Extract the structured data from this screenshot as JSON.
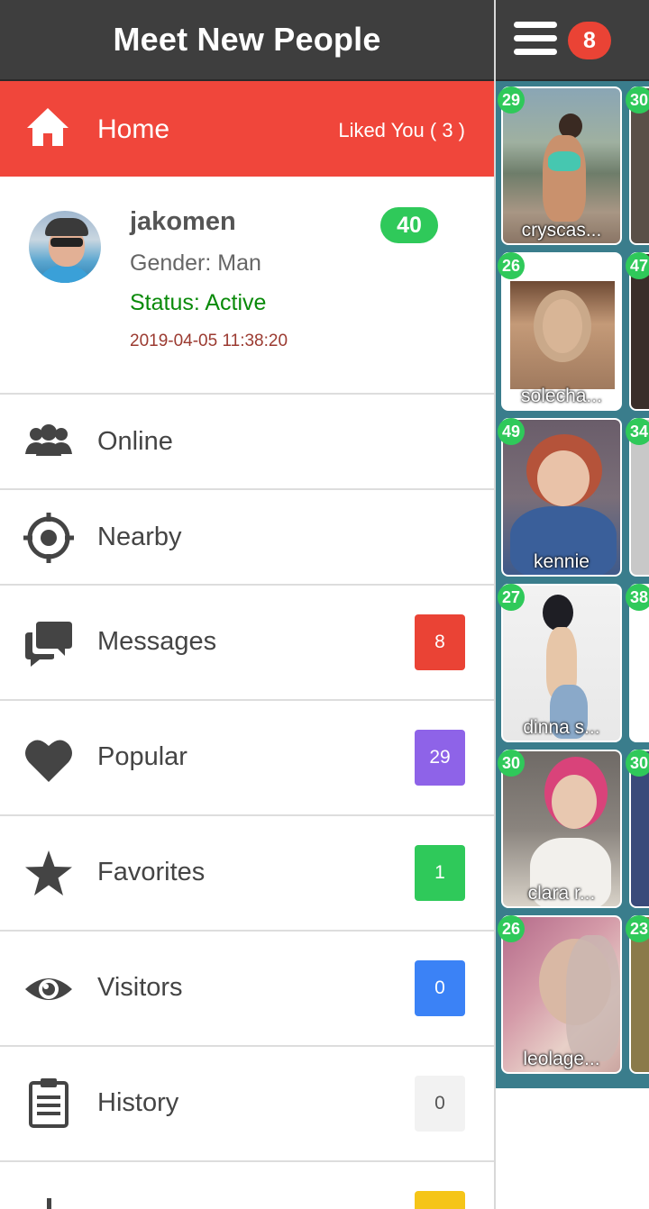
{
  "drawer": {
    "title": "Meet New People",
    "home": {
      "label": "Home",
      "liked": "Liked You ( 3 )"
    },
    "profile": {
      "username": "jakomen",
      "gender": "Gender: Man",
      "status": "Status: Active",
      "timestamp": "2019-04-05 11:38:20",
      "credits": "40"
    },
    "menu": [
      {
        "label": "Online",
        "icon": "users-icon",
        "badge": ""
      },
      {
        "label": "Nearby",
        "icon": "crosshair-icon",
        "badge": ""
      },
      {
        "label": "Messages",
        "icon": "chat-bubbles-icon",
        "badge": "8",
        "badge_color": "#ea4335"
      },
      {
        "label": "Popular",
        "icon": "heart-icon",
        "badge": "29",
        "badge_color": "#8e63e8"
      },
      {
        "label": "Favorites",
        "icon": "star-icon",
        "badge": "1",
        "badge_color": "#2fc95a"
      },
      {
        "label": "Visitors",
        "icon": "eye-icon",
        "badge": "0",
        "badge_color": "#3b82f6"
      },
      {
        "label": "History",
        "icon": "clipboard-icon",
        "badge": "0",
        "badge_color": "#f2f2f2"
      },
      {
        "label": "",
        "icon": "music-icon",
        "badge": "",
        "badge_color": "#f5c518"
      }
    ]
  },
  "topbar": {
    "menu_icon": "hamburger-icon",
    "notifications": "8"
  },
  "grid": {
    "cards": [
      {
        "age": "29",
        "name": "cryscas...",
        "age2": "30"
      },
      {
        "age": "26",
        "name": "solecha...",
        "age2": "47"
      },
      {
        "age": "49",
        "name": "kennie",
        "age2": "34"
      },
      {
        "age": "27",
        "name": "dinna s...",
        "age2": "38"
      },
      {
        "age": "30",
        "name": "clara r...",
        "age2": "30"
      },
      {
        "age": "26",
        "name": "leolage...",
        "age2": "23"
      }
    ]
  },
  "colors": {
    "header": "#3e3e3e",
    "accent_red": "#f0463b",
    "green": "#2fc95a",
    "status_green": "#0a8a0a",
    "timestamp": "#9b3a30"
  }
}
